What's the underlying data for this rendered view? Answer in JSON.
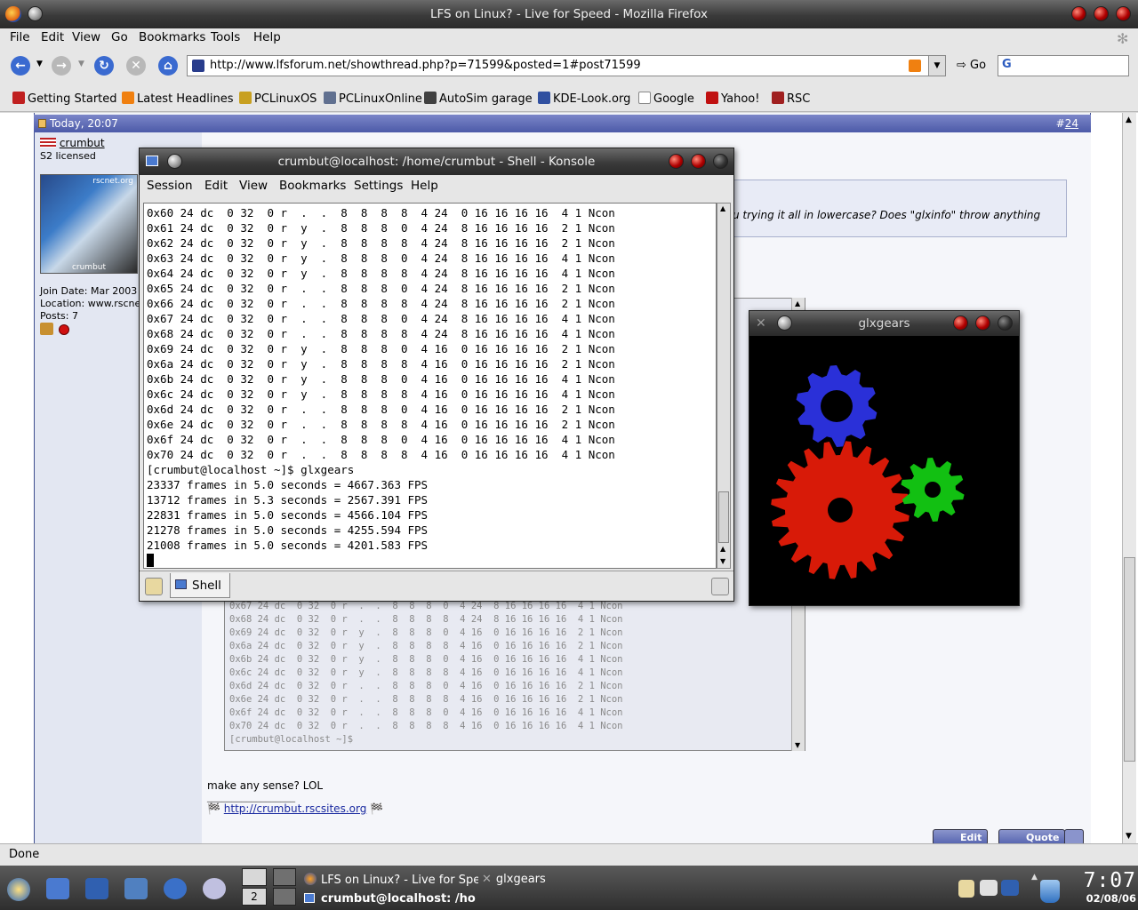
{
  "firefox": {
    "title": "LFS on Linux? - Live for Speed - Mozilla Firefox",
    "menu": [
      "File",
      "Edit",
      "View",
      "Go",
      "Bookmarks",
      "Tools",
      "Help"
    ],
    "url": "http://www.lfsforum.net/showthread.php?p=71599&posted=1#post71599",
    "go_label": "Go",
    "bookmarks": [
      "Getting Started",
      "Latest Headlines",
      "PCLinuxOS",
      "PCLinuxOnline",
      "AutoSim garage",
      "KDE-Look.org",
      "Google",
      "Yahoo!",
      "RSC"
    ],
    "status": "Done"
  },
  "forum": {
    "post_date": "Today, 20:07",
    "post_number_prefix": "#",
    "post_number": "24",
    "username": "crumbut",
    "license": "S2 licensed",
    "avatar_text_top": "rscnet.org",
    "avatar_text_bottom": "crumbut",
    "join_date": "Join Date: Mar 2003",
    "location": "Location: www.rscne",
    "posts": "Posts: 7",
    "quote_text": "u trying it all in lowercase? Does \"glxinfo\" throw anything",
    "post_text": "make any sense? LOL",
    "signature_line": "__________________",
    "signature_link": "http://crumbut.rscsites.org",
    "edit_label": "Edit",
    "quote_label": "Quote"
  },
  "image_terminal_lines": [
    "0x67 24 dc  0 32  0 r  .  .  8  8  8  0  4 24  8 16 16 16 16  4 1 Ncon",
    "0x68 24 dc  0 32  0 r  .  .  8  8  8  8  4 24  8 16 16 16 16  4 1 Ncon",
    "0x69 24 dc  0 32  0 r  y  .  8  8  8  0  4 16  0 16 16 16 16  2 1 Ncon",
    "0x6a 24 dc  0 32  0 r  y  .  8  8  8  8  4 16  0 16 16 16 16  2 1 Ncon",
    "0x6b 24 dc  0 32  0 r  y  .  8  8  8  0  4 16  0 16 16 16 16  4 1 Ncon",
    "0x6c 24 dc  0 32  0 r  y  .  8  8  8  8  4 16  0 16 16 16 16  4 1 Ncon",
    "0x6d 24 dc  0 32  0 r  .  .  8  8  8  0  4 16  0 16 16 16 16  2 1 Ncon",
    "0x6e 24 dc  0 32  0 r  .  .  8  8  8  8  4 16  0 16 16 16 16  2 1 Ncon",
    "0x6f 24 dc  0 32  0 r  .  .  8  8  8  0  4 16  0 16 16 16 16  4 1 Ncon",
    "0x70 24 dc  0 32  0 r  .  .  8  8  8  8  4 16  0 16 16 16 16  4 1 Ncon",
    "[crumbut@localhost ~]$"
  ],
  "konsole": {
    "title": "crumbut@localhost: /home/crumbut - Shell - Konsole",
    "menu": [
      "Session",
      "Edit",
      "View",
      "Bookmarks",
      "Settings",
      "Help"
    ],
    "tab_label": "Shell",
    "lines": [
      "0x60 24 dc  0 32  0 r  .  .  8  8  8  8  4 24  0 16 16 16 16  4 1 Ncon",
      "0x61 24 dc  0 32  0 r  y  .  8  8  8  0  4 24  8 16 16 16 16  2 1 Ncon",
      "0x62 24 dc  0 32  0 r  y  .  8  8  8  8  4 24  8 16 16 16 16  2 1 Ncon",
      "0x63 24 dc  0 32  0 r  y  .  8  8  8  0  4 24  8 16 16 16 16  4 1 Ncon",
      "0x64 24 dc  0 32  0 r  y  .  8  8  8  8  4 24  8 16 16 16 16  4 1 Ncon",
      "0x65 24 dc  0 32  0 r  .  .  8  8  8  0  4 24  8 16 16 16 16  2 1 Ncon",
      "0x66 24 dc  0 32  0 r  .  .  8  8  8  8  4 24  8 16 16 16 16  2 1 Ncon",
      "0x67 24 dc  0 32  0 r  .  .  8  8  8  0  4 24  8 16 16 16 16  4 1 Ncon",
      "0x68 24 dc  0 32  0 r  .  .  8  8  8  8  4 24  8 16 16 16 16  4 1 Ncon",
      "0x69 24 dc  0 32  0 r  y  .  8  8  8  0  4 16  0 16 16 16 16  2 1 Ncon",
      "0x6a 24 dc  0 32  0 r  y  .  8  8  8  8  4 16  0 16 16 16 16  2 1 Ncon",
      "0x6b 24 dc  0 32  0 r  y  .  8  8  8  0  4 16  0 16 16 16 16  4 1 Ncon",
      "0x6c 24 dc  0 32  0 r  y  .  8  8  8  8  4 16  0 16 16 16 16  4 1 Ncon",
      "0x6d 24 dc  0 32  0 r  .  .  8  8  8  0  4 16  0 16 16 16 16  2 1 Ncon",
      "0x6e 24 dc  0 32  0 r  .  .  8  8  8  8  4 16  0 16 16 16 16  2 1 Ncon",
      "0x6f 24 dc  0 32  0 r  .  .  8  8  8  0  4 16  0 16 16 16 16  4 1 Ncon",
      "0x70 24 dc  0 32  0 r  .  .  8  8  8  8  4 16  0 16 16 16 16  4 1 Ncon",
      "[crumbut@localhost ~]$ glxgears",
      "23337 frames in 5.0 seconds = 4667.363 FPS",
      "13712 frames in 5.3 seconds = 2567.391 FPS",
      "22831 frames in 5.0 seconds = 4566.104 FPS",
      "21278 frames in 5.0 seconds = 4255.594 FPS",
      "21008 frames in 5.0 seconds = 4201.583 FPS"
    ]
  },
  "glxgears": {
    "title": "glxgears",
    "gear_colors": [
      "#2a30d8",
      "#d81a08",
      "#12c012"
    ]
  },
  "taskbar": {
    "desktop_number": "2",
    "tasks": [
      "LFS on Linux? - Live for Spe",
      "glxgears",
      "crumbut@localhost: /ho"
    ],
    "time": "7:07",
    "date": "02/08/06"
  }
}
